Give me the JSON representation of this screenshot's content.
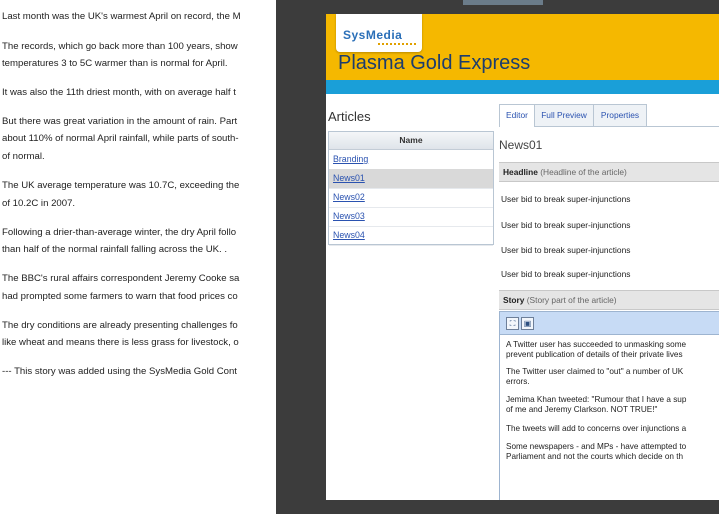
{
  "article_text": {
    "paragraphs": [
      "Last month was the UK's warmest April on record, the M",
      "The records, which go back more than 100 years, show",
      "temperatures 3 to 5C warmer than is normal for April.",
      "It was also the 11th driest month, with on average half t",
      "But there was great variation in the amount of rain. Part",
      "about 110% of normal April rainfall, while parts of south-",
      "of normal.",
      "The UK average temperature was 10.7C, exceeding the",
      "of 10.2C in 2007.",
      "Following a drier-than-average winter, the dry April follo",
      "than half of the normal rainfall falling across the UK. .",
      "The BBC's rural affairs correspondent Jeremy Cooke sa",
      "had prompted some farmers to warn that food prices co",
      "The dry conditions are already presenting challenges fo",
      "like wheat and means there is less grass for livestock, o",
      "--- This story was added using the SysMedia Gold Cont"
    ]
  },
  "app": {
    "logo": "SysMedia",
    "title": "Plasma Gold Express"
  },
  "articles": {
    "title": "Articles",
    "column_header": "Name",
    "items": [
      "Branding",
      "News01",
      "News02",
      "News03",
      "News04"
    ],
    "selected": "News01"
  },
  "editor": {
    "tabs": [
      "Editor",
      "Full Preview",
      "Properties"
    ],
    "active_tab": "Editor",
    "doc_title": "News01",
    "headline_label": "Headline",
    "headline_hint": "(Headline of the article)",
    "headline_values": [
      "User bid to break super-injunctions",
      "User bid to break super-injunctions",
      "User bid to break super-injunctions",
      "User bid to break super-injunctions"
    ],
    "story_label": "Story",
    "story_hint": "(Story part of the article)",
    "story_lines": [
      "A Twitter user has succeeded to unmasking some",
      "prevent publication of details of their private lives",
      "The Twitter user claimed to \"out\" a number of UK",
      "errors.",
      "Jemima Khan tweeted: \"Rumour that I have a sup",
      "of me and Jeremy Clarkson. NOT TRUE!\"",
      "The tweets will add to concerns over injunctions a",
      "Some newspapers - and MPs - have attempted to",
      "Parliament and not the courts which decide on th"
    ]
  },
  "colors": {
    "header": "#f5b800",
    "header_band": "#1a9fd8",
    "link": "#2a52b0",
    "toolbar": "#c7dbf5"
  }
}
